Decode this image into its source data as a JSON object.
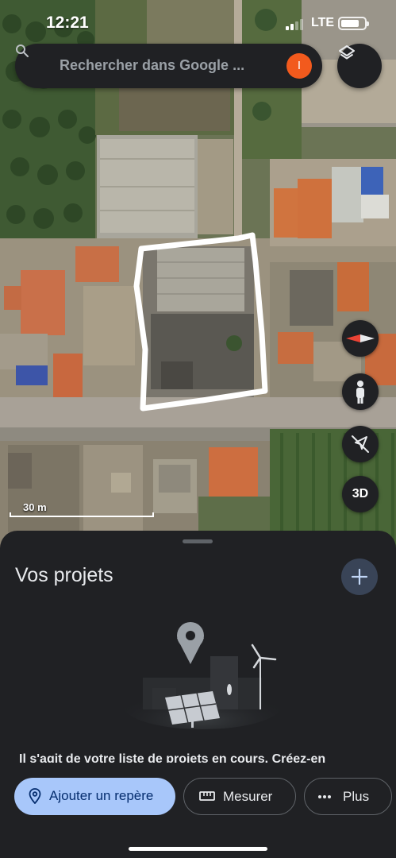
{
  "status_bar": {
    "time": "12:21",
    "network": "LTE",
    "battery_level": 0.8
  },
  "search": {
    "placeholder": "Rechercher dans Google ...",
    "avatar_initial": "I",
    "avatar_color": "#f25a1d"
  },
  "map": {
    "scale_label": "30 m",
    "controls": {
      "label_3d": "3D"
    },
    "icons": [
      "layers-icon",
      "compass-icon",
      "street-view-icon",
      "location-off-icon"
    ]
  },
  "sheet": {
    "title": "Vos projets",
    "empty_message": "Il s'agit de votre liste de projets en cours. Créez-en",
    "actions": [
      {
        "label": "Ajouter un repère",
        "icon": "location-pin-icon"
      },
      {
        "label": "Mesurer",
        "icon": "ruler-icon"
      },
      {
        "label": "Plus",
        "icon": "more-horizontal-icon"
      }
    ]
  },
  "colors": {
    "sheet_background": "#202124",
    "primary_chip": "#a8c7fa",
    "primary_chip_text": "#062e6f",
    "fab": "#394457",
    "compass_red": "#ea4335"
  }
}
